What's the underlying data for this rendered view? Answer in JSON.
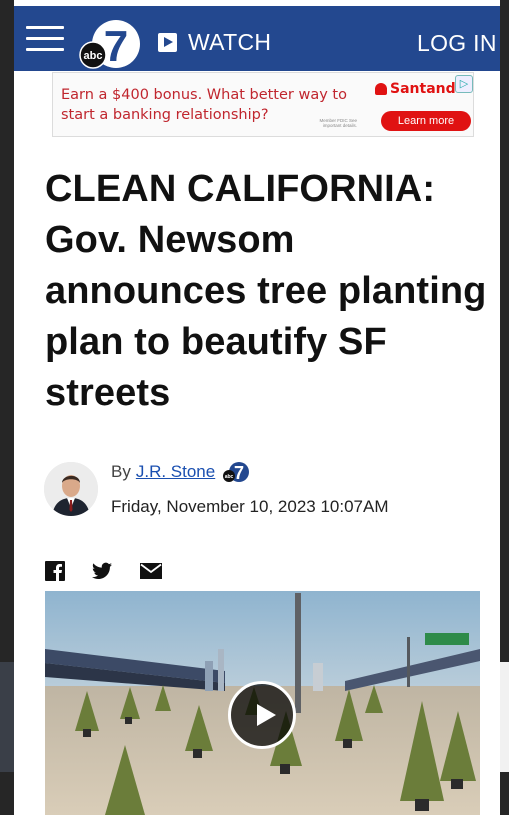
{
  "header": {
    "watch_label": "WATCH",
    "login_label": "LOG IN",
    "logo_text": "abc",
    "logo_numeral": "7",
    "brand_color": "#23488f"
  },
  "ad": {
    "text": "Earn a $400 bonus. What better way to start a banking relationship?",
    "brand": "Santander",
    "cta": "Learn more",
    "fine_print": "Member FDIC See important details.",
    "accent_color": "#e01212"
  },
  "article": {
    "headline": "CLEAN CALIFORNIA: Gov. Newsom announces tree planting plan to beautify SF streets",
    "by_prefix": "By",
    "author": "J.R. Stone",
    "date": "Friday, November 10, 2023 10:07AM"
  },
  "share": {
    "icons": [
      "facebook-icon",
      "twitter-icon",
      "email-icon"
    ]
  },
  "video": {
    "icon": "play-icon"
  }
}
